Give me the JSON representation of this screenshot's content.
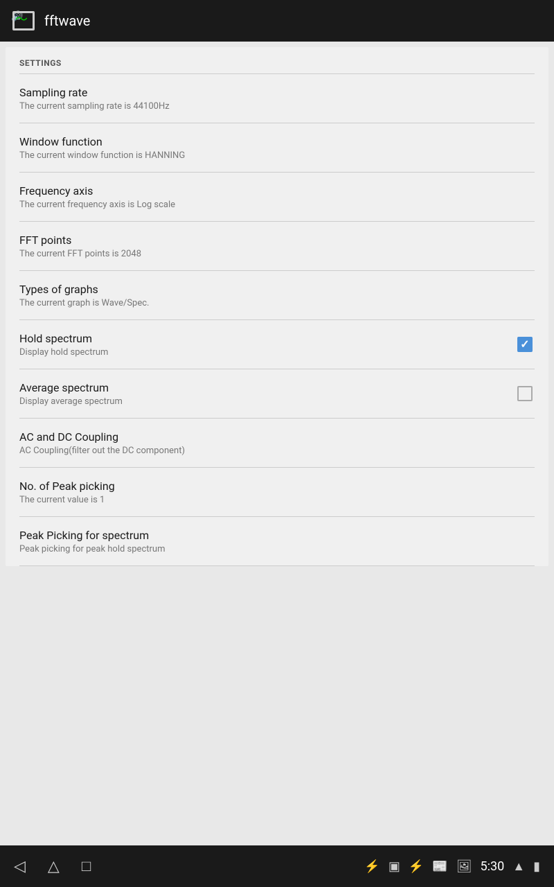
{
  "appBar": {
    "title": "fftwave",
    "iconLabel": "fftwave-app-icon"
  },
  "settings": {
    "header": "SETTINGS",
    "items": [
      {
        "id": "sampling-rate",
        "title": "Sampling rate",
        "subtitle": "The current sampling rate is 44100Hz",
        "hasControl": false
      },
      {
        "id": "window-function",
        "title": "Window function",
        "subtitle": "The current window function is HANNING",
        "hasControl": false
      },
      {
        "id": "frequency-axis",
        "title": "Frequency axis",
        "subtitle": "The current frequency axis is Log scale",
        "hasControl": false
      },
      {
        "id": "fft-points",
        "title": "FFT points",
        "subtitle": "The current FFT points is 2048",
        "hasControl": false
      },
      {
        "id": "types-of-graphs",
        "title": "Types of graphs",
        "subtitle": "The current graph is Wave/Spec.",
        "hasControl": false
      },
      {
        "id": "hold-spectrum",
        "title": "Hold spectrum",
        "subtitle": "Display hold spectrum",
        "hasControl": true,
        "checked": true
      },
      {
        "id": "average-spectrum",
        "title": "Average spectrum",
        "subtitle": "Display average spectrum",
        "hasControl": true,
        "checked": false
      },
      {
        "id": "ac-dc-coupling",
        "title": "AC and DC Coupling",
        "subtitle": "AC Coupling(filter out the DC component)",
        "hasControl": false
      },
      {
        "id": "no-peak-picking",
        "title": "No. of Peak picking",
        "subtitle": "The current value is 1",
        "hasControl": false
      },
      {
        "id": "peak-picking-spectrum",
        "title": "Peak Picking for spectrum",
        "subtitle": "Peak picking for peak hold spectrum",
        "hasControl": false
      }
    ]
  },
  "navBar": {
    "time": "5:30",
    "backIcon": "◁",
    "homeIcon": "△",
    "recentIcon": "□",
    "usbIcon": "USB",
    "batteryLevel": "100"
  }
}
